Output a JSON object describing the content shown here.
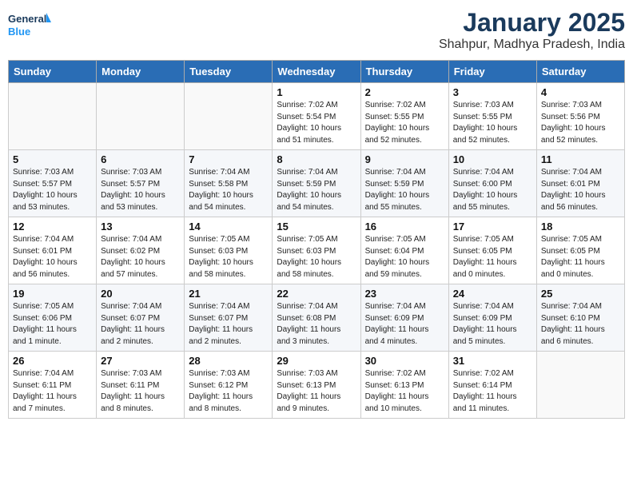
{
  "header": {
    "logo_line1": "General",
    "logo_line2": "Blue",
    "month": "January 2025",
    "location": "Shahpur, Madhya Pradesh, India"
  },
  "weekdays": [
    "Sunday",
    "Monday",
    "Tuesday",
    "Wednesday",
    "Thursday",
    "Friday",
    "Saturday"
  ],
  "weeks": [
    [
      {
        "day": "",
        "sunrise": "",
        "sunset": "",
        "daylight": ""
      },
      {
        "day": "",
        "sunrise": "",
        "sunset": "",
        "daylight": ""
      },
      {
        "day": "",
        "sunrise": "",
        "sunset": "",
        "daylight": ""
      },
      {
        "day": "1",
        "sunrise": "Sunrise: 7:02 AM",
        "sunset": "Sunset: 5:54 PM",
        "daylight": "Daylight: 10 hours and 51 minutes."
      },
      {
        "day": "2",
        "sunrise": "Sunrise: 7:02 AM",
        "sunset": "Sunset: 5:55 PM",
        "daylight": "Daylight: 10 hours and 52 minutes."
      },
      {
        "day": "3",
        "sunrise": "Sunrise: 7:03 AM",
        "sunset": "Sunset: 5:55 PM",
        "daylight": "Daylight: 10 hours and 52 minutes."
      },
      {
        "day": "4",
        "sunrise": "Sunrise: 7:03 AM",
        "sunset": "Sunset: 5:56 PM",
        "daylight": "Daylight: 10 hours and 52 minutes."
      }
    ],
    [
      {
        "day": "5",
        "sunrise": "Sunrise: 7:03 AM",
        "sunset": "Sunset: 5:57 PM",
        "daylight": "Daylight: 10 hours and 53 minutes."
      },
      {
        "day": "6",
        "sunrise": "Sunrise: 7:03 AM",
        "sunset": "Sunset: 5:57 PM",
        "daylight": "Daylight: 10 hours and 53 minutes."
      },
      {
        "day": "7",
        "sunrise": "Sunrise: 7:04 AM",
        "sunset": "Sunset: 5:58 PM",
        "daylight": "Daylight: 10 hours and 54 minutes."
      },
      {
        "day": "8",
        "sunrise": "Sunrise: 7:04 AM",
        "sunset": "Sunset: 5:59 PM",
        "daylight": "Daylight: 10 hours and 54 minutes."
      },
      {
        "day": "9",
        "sunrise": "Sunrise: 7:04 AM",
        "sunset": "Sunset: 5:59 PM",
        "daylight": "Daylight: 10 hours and 55 minutes."
      },
      {
        "day": "10",
        "sunrise": "Sunrise: 7:04 AM",
        "sunset": "Sunset: 6:00 PM",
        "daylight": "Daylight: 10 hours and 55 minutes."
      },
      {
        "day": "11",
        "sunrise": "Sunrise: 7:04 AM",
        "sunset": "Sunset: 6:01 PM",
        "daylight": "Daylight: 10 hours and 56 minutes."
      }
    ],
    [
      {
        "day": "12",
        "sunrise": "Sunrise: 7:04 AM",
        "sunset": "Sunset: 6:01 PM",
        "daylight": "Daylight: 10 hours and 56 minutes."
      },
      {
        "day": "13",
        "sunrise": "Sunrise: 7:04 AM",
        "sunset": "Sunset: 6:02 PM",
        "daylight": "Daylight: 10 hours and 57 minutes."
      },
      {
        "day": "14",
        "sunrise": "Sunrise: 7:05 AM",
        "sunset": "Sunset: 6:03 PM",
        "daylight": "Daylight: 10 hours and 58 minutes."
      },
      {
        "day": "15",
        "sunrise": "Sunrise: 7:05 AM",
        "sunset": "Sunset: 6:03 PM",
        "daylight": "Daylight: 10 hours and 58 minutes."
      },
      {
        "day": "16",
        "sunrise": "Sunrise: 7:05 AM",
        "sunset": "Sunset: 6:04 PM",
        "daylight": "Daylight: 10 hours and 59 minutes."
      },
      {
        "day": "17",
        "sunrise": "Sunrise: 7:05 AM",
        "sunset": "Sunset: 6:05 PM",
        "daylight": "Daylight: 11 hours and 0 minutes."
      },
      {
        "day": "18",
        "sunrise": "Sunrise: 7:05 AM",
        "sunset": "Sunset: 6:05 PM",
        "daylight": "Daylight: 11 hours and 0 minutes."
      }
    ],
    [
      {
        "day": "19",
        "sunrise": "Sunrise: 7:05 AM",
        "sunset": "Sunset: 6:06 PM",
        "daylight": "Daylight: 11 hours and 1 minute."
      },
      {
        "day": "20",
        "sunrise": "Sunrise: 7:04 AM",
        "sunset": "Sunset: 6:07 PM",
        "daylight": "Daylight: 11 hours and 2 minutes."
      },
      {
        "day": "21",
        "sunrise": "Sunrise: 7:04 AM",
        "sunset": "Sunset: 6:07 PM",
        "daylight": "Daylight: 11 hours and 2 minutes."
      },
      {
        "day": "22",
        "sunrise": "Sunrise: 7:04 AM",
        "sunset": "Sunset: 6:08 PM",
        "daylight": "Daylight: 11 hours and 3 minutes."
      },
      {
        "day": "23",
        "sunrise": "Sunrise: 7:04 AM",
        "sunset": "Sunset: 6:09 PM",
        "daylight": "Daylight: 11 hours and 4 minutes."
      },
      {
        "day": "24",
        "sunrise": "Sunrise: 7:04 AM",
        "sunset": "Sunset: 6:09 PM",
        "daylight": "Daylight: 11 hours and 5 minutes."
      },
      {
        "day": "25",
        "sunrise": "Sunrise: 7:04 AM",
        "sunset": "Sunset: 6:10 PM",
        "daylight": "Daylight: 11 hours and 6 minutes."
      }
    ],
    [
      {
        "day": "26",
        "sunrise": "Sunrise: 7:04 AM",
        "sunset": "Sunset: 6:11 PM",
        "daylight": "Daylight: 11 hours and 7 minutes."
      },
      {
        "day": "27",
        "sunrise": "Sunrise: 7:03 AM",
        "sunset": "Sunset: 6:11 PM",
        "daylight": "Daylight: 11 hours and 8 minutes."
      },
      {
        "day": "28",
        "sunrise": "Sunrise: 7:03 AM",
        "sunset": "Sunset: 6:12 PM",
        "daylight": "Daylight: 11 hours and 8 minutes."
      },
      {
        "day": "29",
        "sunrise": "Sunrise: 7:03 AM",
        "sunset": "Sunset: 6:13 PM",
        "daylight": "Daylight: 11 hours and 9 minutes."
      },
      {
        "day": "30",
        "sunrise": "Sunrise: 7:02 AM",
        "sunset": "Sunset: 6:13 PM",
        "daylight": "Daylight: 11 hours and 10 minutes."
      },
      {
        "day": "31",
        "sunrise": "Sunrise: 7:02 AM",
        "sunset": "Sunset: 6:14 PM",
        "daylight": "Daylight: 11 hours and 11 minutes."
      },
      {
        "day": "",
        "sunrise": "",
        "sunset": "",
        "daylight": ""
      }
    ]
  ]
}
